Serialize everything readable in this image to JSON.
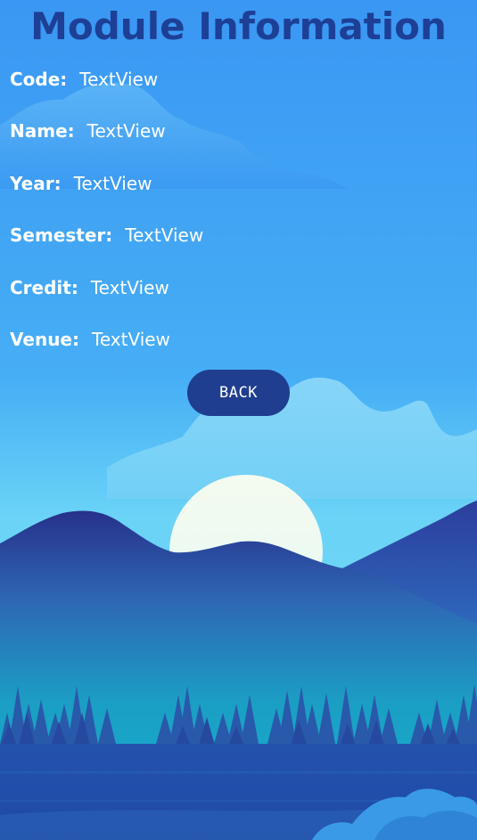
{
  "screen": {
    "title": "Module Information"
  },
  "fields": [
    {
      "label": "Code:",
      "value": "TextView"
    },
    {
      "label": "Name:",
      "value": "TextView"
    },
    {
      "label": "Year:",
      "value": "TextView"
    },
    {
      "label": "Semester:",
      "value": "TextView"
    },
    {
      "label": "Credit:",
      "value": "TextView"
    },
    {
      "label": "Venue:",
      "value": "TextView"
    }
  ],
  "actions": {
    "back_label": "BACK"
  },
  "colors": {
    "title": "#1e3f96",
    "button": "#203e8f",
    "text": "#ffffff",
    "sky_top": "#3a98f3",
    "sky_bottom": "#6fd7f6"
  }
}
